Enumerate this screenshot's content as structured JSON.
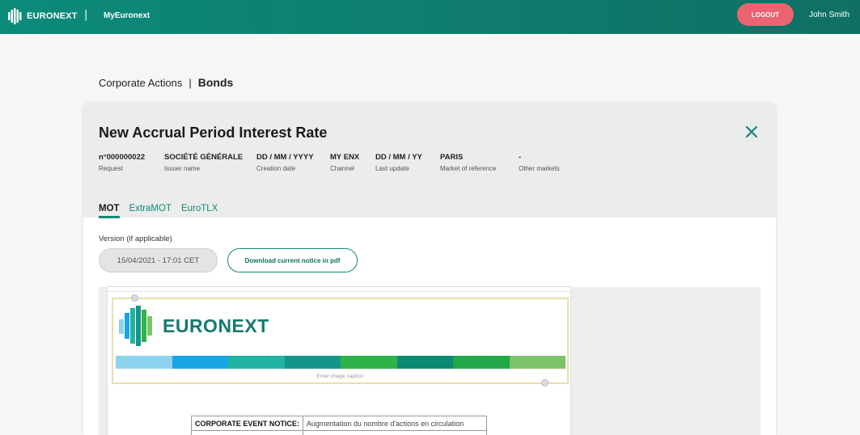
{
  "header": {
    "brand": "EURONEXT",
    "app_name": "MyEuronext",
    "logout_label": "LOGOUT",
    "user_name": "John Smith"
  },
  "breadcrumb": {
    "parent": "Corporate Actions",
    "separator": "|",
    "current": "Bonds"
  },
  "notice": {
    "title": "New Accrual Period Interest Rate",
    "meta": [
      {
        "value": "n°000000022",
        "label": "Request"
      },
      {
        "value": "SOCIÉTÉ GÉNÉRALE",
        "label": "Issuer name"
      },
      {
        "value": "DD / MM / YYYY",
        "label": "Creation date"
      },
      {
        "value": "MY ENX",
        "label": "Channel"
      },
      {
        "value": "DD / MM / YY",
        "label": "Last update"
      },
      {
        "value": "PARIS",
        "label": "Market of reference"
      },
      {
        "value": "-",
        "label": "Other markets"
      }
    ],
    "tabs": [
      {
        "label": "MOT",
        "active": true
      },
      {
        "label": "ExtraMOT",
        "active": false
      },
      {
        "label": "EuroTLX",
        "active": false
      }
    ],
    "version_label": "Version (if applicable)",
    "version_value": "15/04/2021 - 17:01 CET",
    "download_label": "Download current notice in pdf"
  },
  "document": {
    "logo_text": "EURONEXT",
    "caption": "Enter image caption",
    "stripe_colors": [
      "#8dd3ee",
      "#1aa6e4",
      "#22b3a3",
      "#14958a",
      "#2fb24a",
      "#0c8a73",
      "#23a74a",
      "#7dc36a"
    ],
    "table": [
      {
        "key": "CORPORATE EVENT NOTICE:",
        "value": "Augmentation du nombre d'actions en circulation"
      },
      {
        "key": "",
        "value": ""
      }
    ]
  },
  "colors": {
    "brand_teal": "#0f8a76",
    "logout": "#e96371"
  },
  "icons": {
    "close": "close-icon",
    "logo": "euronext-logo-icon"
  }
}
